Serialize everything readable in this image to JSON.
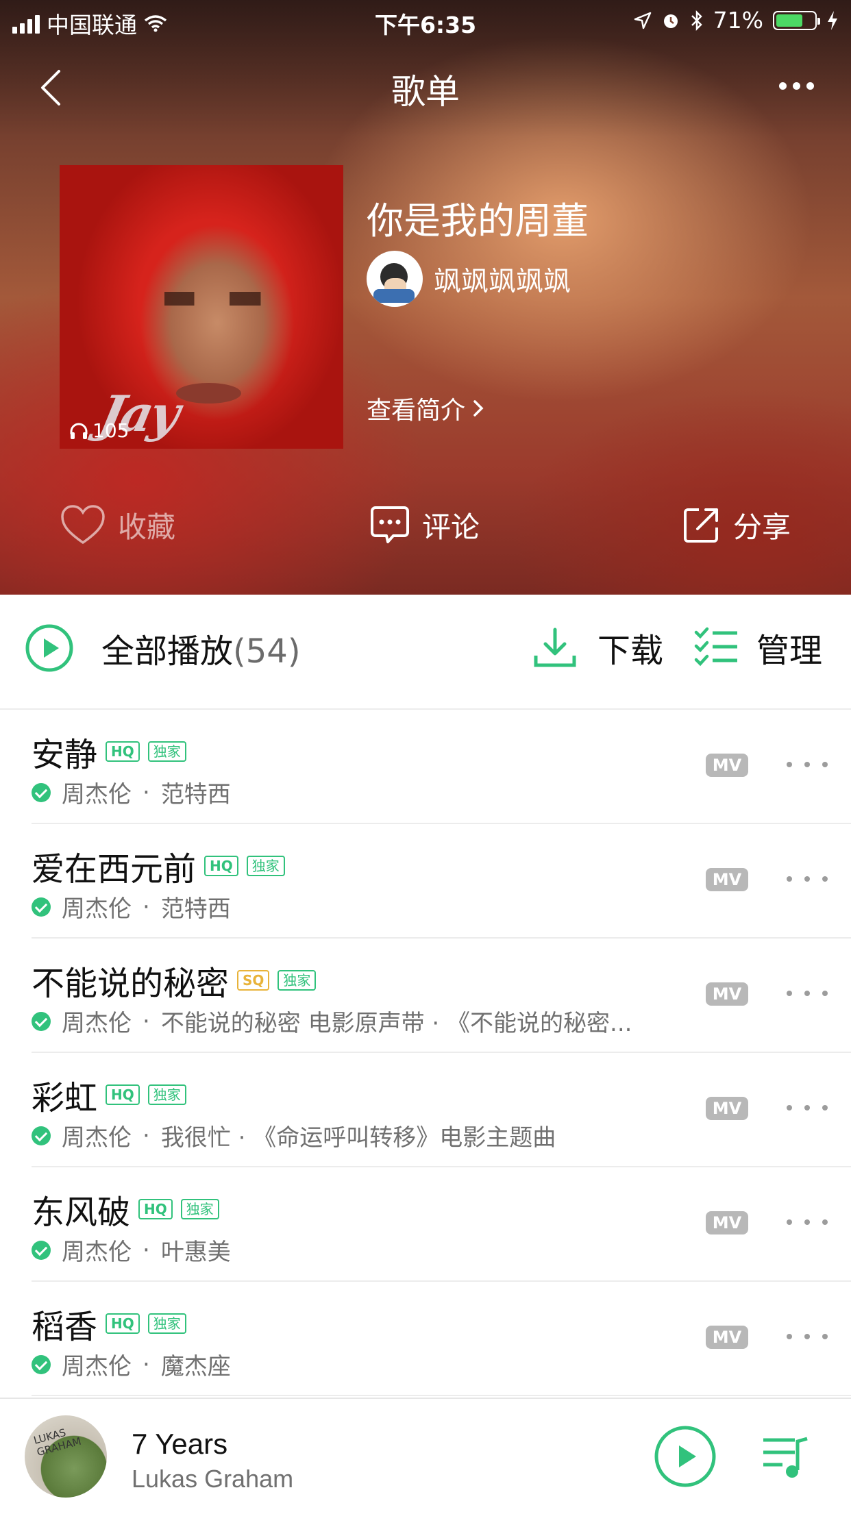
{
  "status": {
    "carrier": "中国联通",
    "time": "下午6:35",
    "battery": "71%",
    "battery_level": 0.71
  },
  "nav": {
    "title": "歌单"
  },
  "playlist": {
    "title": "你是我的周董",
    "creator": "飒飒飒飒飒",
    "play_count": "105",
    "intro_label": "查看简介",
    "cover_text": "Jay"
  },
  "actions": {
    "favorite": "收藏",
    "comment": "评论",
    "share": "分享"
  },
  "playbar": {
    "play_all": "全部播放",
    "count": "(54)",
    "download": "下载",
    "manage": "管理"
  },
  "songs": [
    {
      "name": "安静",
      "quality": "HQ",
      "tag": "独家",
      "artist": "周杰伦",
      "album": "范特西",
      "mv": "MV"
    },
    {
      "name": "爱在西元前",
      "quality": "HQ",
      "tag": "独家",
      "artist": "周杰伦",
      "album": "范特西",
      "mv": "MV"
    },
    {
      "name": "不能说的秘密",
      "quality": "SQ",
      "tag": "独家",
      "artist": "周杰伦",
      "album": "不能说的秘密 电影原声带 · 《不能说的秘密...",
      "mv": "MV"
    },
    {
      "name": "彩虹",
      "quality": "HQ",
      "tag": "独家",
      "artist": "周杰伦",
      "album": "我很忙 · 《命运呼叫转移》电影主题曲",
      "mv": "MV"
    },
    {
      "name": "东风破",
      "quality": "HQ",
      "tag": "独家",
      "artist": "周杰伦",
      "album": "叶惠美",
      "mv": "MV"
    },
    {
      "name": "稻香",
      "quality": "HQ",
      "tag": "独家",
      "artist": "周杰伦",
      "album": "魔杰座",
      "mv": "MV"
    }
  ],
  "separator": "·",
  "now_playing": {
    "title": "7 Years",
    "artist": "Lukas Graham",
    "art_text": "LUKAS GRAHAM"
  },
  "colors": {
    "accent": "#31c27c",
    "sq": "#e8b33a",
    "mv_badge": "#b8b8b8"
  }
}
